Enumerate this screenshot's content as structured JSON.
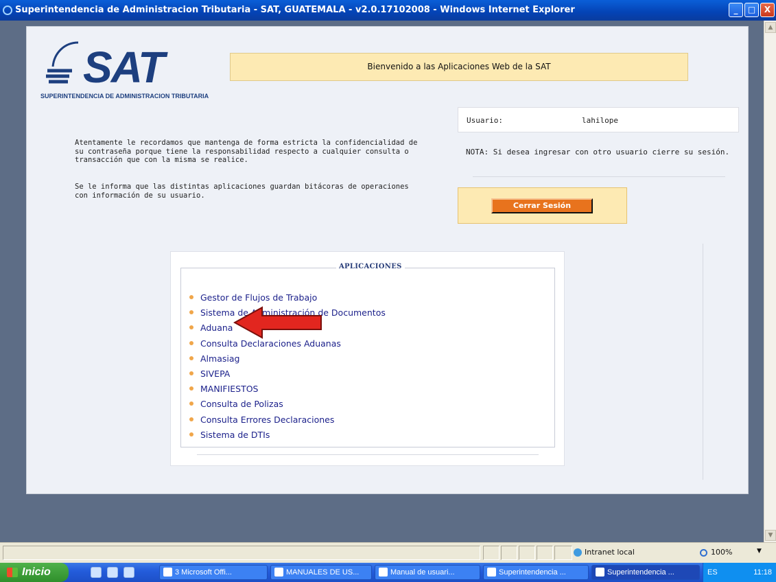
{
  "window": {
    "title": "Superintendencia de Administracion Tributaria - SAT, GUATEMALA - v2.0.17102008 - Windows Internet Explorer",
    "minimize": "_",
    "maximize": "□",
    "close": "X"
  },
  "header": {
    "logo_text": "SAT",
    "logo_subtitle": "SUPERINTENDENCIA DE ADMINISTRACION TRIBUTARIA",
    "welcome": "Bienvenido a las Aplicaciones Web de la SAT"
  },
  "user": {
    "label": "Usuario:",
    "value": "lahilope",
    "nota": "NOTA: Si desea ingresar con otro usuario cierre su sesión."
  },
  "messages": {
    "confidencialidad": "Atentamente le recordamos que mantenga de forma estricta la confidencialidad de su contraseña porque tiene la responsabilidad respecto a cualquier consulta o transacción que con la misma se realice.",
    "bitacoras": "Se le informa que las distintas aplicaciones guardan bitácoras de operaciones con información de su usuario."
  },
  "logout_button": "Cerrar Sesión",
  "applications": {
    "legend": "APLICACIONES",
    "items": [
      "Gestor de Flujos de Trabajo",
      "Sistema de Administración de Documentos",
      "Aduana",
      "Consulta Declaraciones Aduanas",
      "Almasiag",
      "SIVEPA",
      "MANIFIESTOS",
      "Consulta de Polizas",
      "Consulta Errores Declaraciones",
      "Sistema de DTIs"
    ]
  },
  "annotation": {
    "color": "#e2261f"
  },
  "statusbar": {
    "zone": "Intranet local",
    "zoom": "100%"
  },
  "taskbar": {
    "start": "Inicio",
    "tasks": [
      "3 Microsoft Offi...",
      "MANUALES DE US...",
      "Manual de usuari...",
      "Superintendencia ...",
      "Superintendencia ..."
    ],
    "lang": "ES",
    "clock": "11:18"
  }
}
